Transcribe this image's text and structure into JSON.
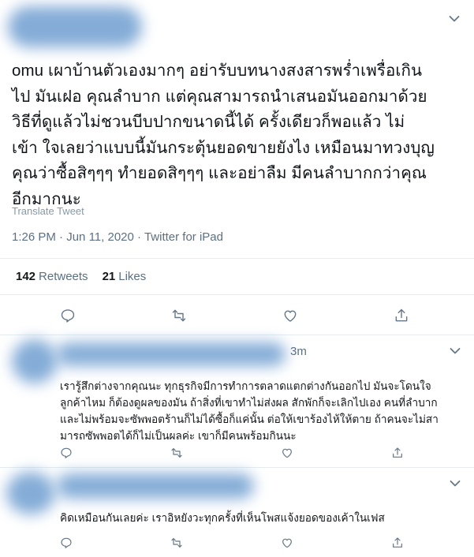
{
  "tweet": {
    "lines": [
      "omu เผาบ้านตัวเองมากๆ อย่ารับบทนางสงสารพร่ำเพรื่อเกิน",
      "ไป มันเฝอ คุณลำบาก แต่คุณสามารถนำเสนอมันออกมาด้วย",
      "วิธีที่ดูแล้วไม่ชวนบีบปากขนาดนี้ได้ ครั้งเดียวก็พอแล้ว ไม่",
      "เข้า ใจเลยว่าแบบนี้มันกระตุ้นยอดขายยังไง เหมือนมาทวงบุญ",
      "คุณว่าซื้อสิๆๆๆ ทำยอดสิๆๆๆ และอย่าลืม มีคนลำบากกว่าคุณ",
      "อีกมากนะ"
    ],
    "translate_label": "Translate Tweet",
    "time": "1:26 PM",
    "date": "Jun 11, 2020",
    "source": "Twitter for iPad",
    "retweets_count": "142",
    "retweets_label": "Retweets",
    "likes_count": "21",
    "likes_label": "Likes"
  },
  "replies": [
    {
      "time": "3m",
      "lines": [
        "เรารู้สึกต่างจากคุณนะ ทุกธุรกิจมีการทำการตลาดแตกต่างกันออกไป มันจะโดนใจ",
        "ลูกค้าไหม ก็ต้องดูผลของมัน ถ้าสิ่งที่เขาทำไม่ส่งผล สักพักก็จะเลิกไปเอง คนที่ลำบาก",
        "และไม่พร้อมจะซัพพอตร้านก็ไม่ได้ซื้อก็แค่นั้น ต่อให้เขาร้องไห้ให้ตาย ถ้าคนจะไม่สา",
        "มารถซัพพอตได้ก็ไม่เป็นผลค่ะ เขาก็มีคนพร้อมกินนะ"
      ]
    },
    {
      "time": "",
      "lines": [
        "คิดเหมือนกันเลยค่ะ เราอิหยังวะทุกครั้งที่เห็นโพสแจ้งยอดของเค้าในเฟส"
      ]
    }
  ],
  "icons": {
    "reply": "reply-icon",
    "retweet": "retweet-icon",
    "like": "heart-icon",
    "share": "share-icon",
    "more": "chevron-down-icon"
  },
  "colors": {
    "icon": "#657786",
    "blur": "#6f9ed0",
    "muted": "#5b7083"
  }
}
